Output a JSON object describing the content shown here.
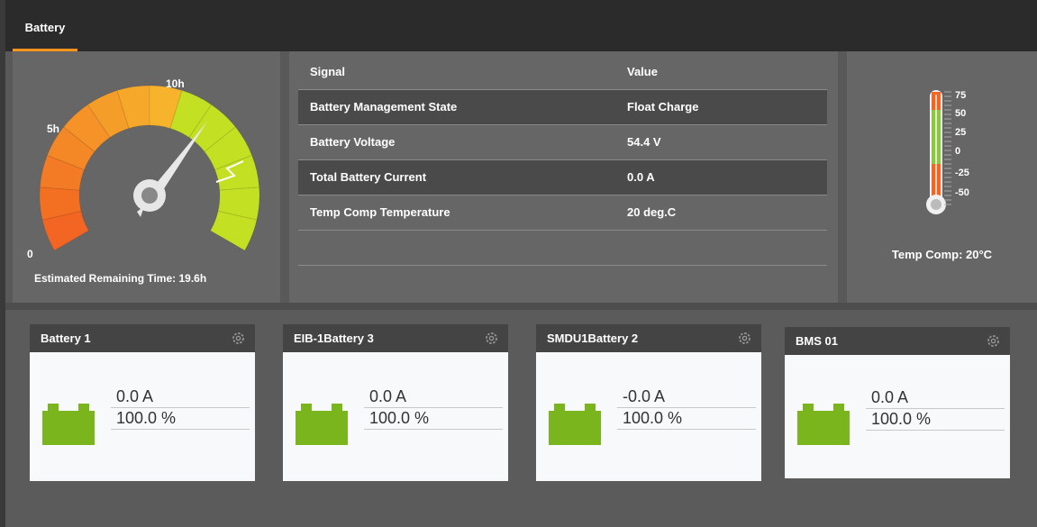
{
  "tabs": [
    {
      "label": "Battery",
      "active": true
    }
  ],
  "gauge": {
    "scale_labels": {
      "zero": "0",
      "five": "5h",
      "ten": "10h"
    },
    "caption": "Estimated Remaining Time: 19.6h",
    "value_hours": 19.6,
    "colors": {
      "low": "#f26522",
      "mid": "#f7b52c",
      "high": "#c4e022"
    }
  },
  "signals": {
    "headers": {
      "signal": "Signal",
      "value": "Value"
    },
    "rows": [
      {
        "signal": "Battery Management State",
        "value": "Float Charge"
      },
      {
        "signal": "Battery Voltage",
        "value": "54.4 V"
      },
      {
        "signal": "Total Battery Current",
        "value": "0.0 A"
      },
      {
        "signal": "Temp Comp Temperature",
        "value": "20 deg.C"
      }
    ]
  },
  "temp": {
    "ticks": [
      "75",
      "50",
      "25",
      "0",
      "-25",
      "-50"
    ],
    "caption": "Temp Comp: 20°C",
    "value_c": 20
  },
  "batteries": [
    {
      "name": "Battery 1",
      "current": "0.0 A",
      "capacity": "100.0 %"
    },
    {
      "name": "EIB-1Battery 3",
      "current": "0.0 A",
      "capacity": "100.0 %"
    },
    {
      "name": "SMDU1Battery 2",
      "current": "-0.0 A",
      "capacity": "100.0 %"
    },
    {
      "name": "BMS 01",
      "current": "0.0 A",
      "capacity": "100.0 %"
    }
  ],
  "colors": {
    "accent": "#f7941d",
    "battery_green": "#7ab51d"
  }
}
